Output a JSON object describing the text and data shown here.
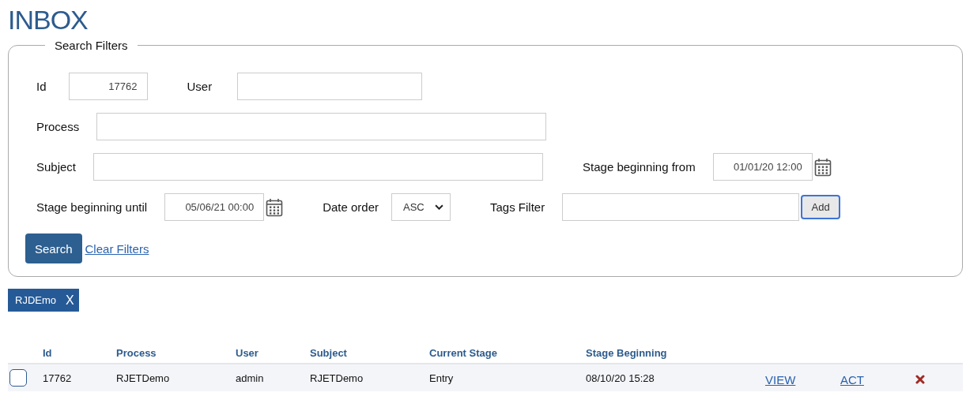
{
  "title": "INBOX",
  "filters": {
    "legend": "Search Filters",
    "id": {
      "label": "Id",
      "value": "17762"
    },
    "user": {
      "label": "User"
    },
    "process": {
      "label": "Process"
    },
    "subject": {
      "label": "Subject"
    },
    "stage_from": {
      "label": "Stage beginning from",
      "value": "01/01/20 12:00"
    },
    "stage_until": {
      "label": "Stage beginning until",
      "value": "05/06/21 00:00"
    },
    "date_order": {
      "label": "Date order",
      "value": "ASC"
    },
    "tags": {
      "label": "Tags Filter",
      "button": "Add"
    },
    "search_button": "Search",
    "clear_link": "Clear Filters"
  },
  "tags": [
    {
      "label": "RJDEmo",
      "remove": "X"
    }
  ],
  "table": {
    "columns": [
      "Id",
      "Process",
      "User",
      "Subject",
      "Current Stage",
      "Stage Beginning"
    ],
    "rows": [
      {
        "checked": false,
        "cells": [
          "17762",
          "RJETDemo",
          "admin",
          "RJETDemo",
          "Entry",
          "08/10/20 15:28"
        ],
        "view": "VIEW",
        "act": "ACT"
      }
    ]
  }
}
